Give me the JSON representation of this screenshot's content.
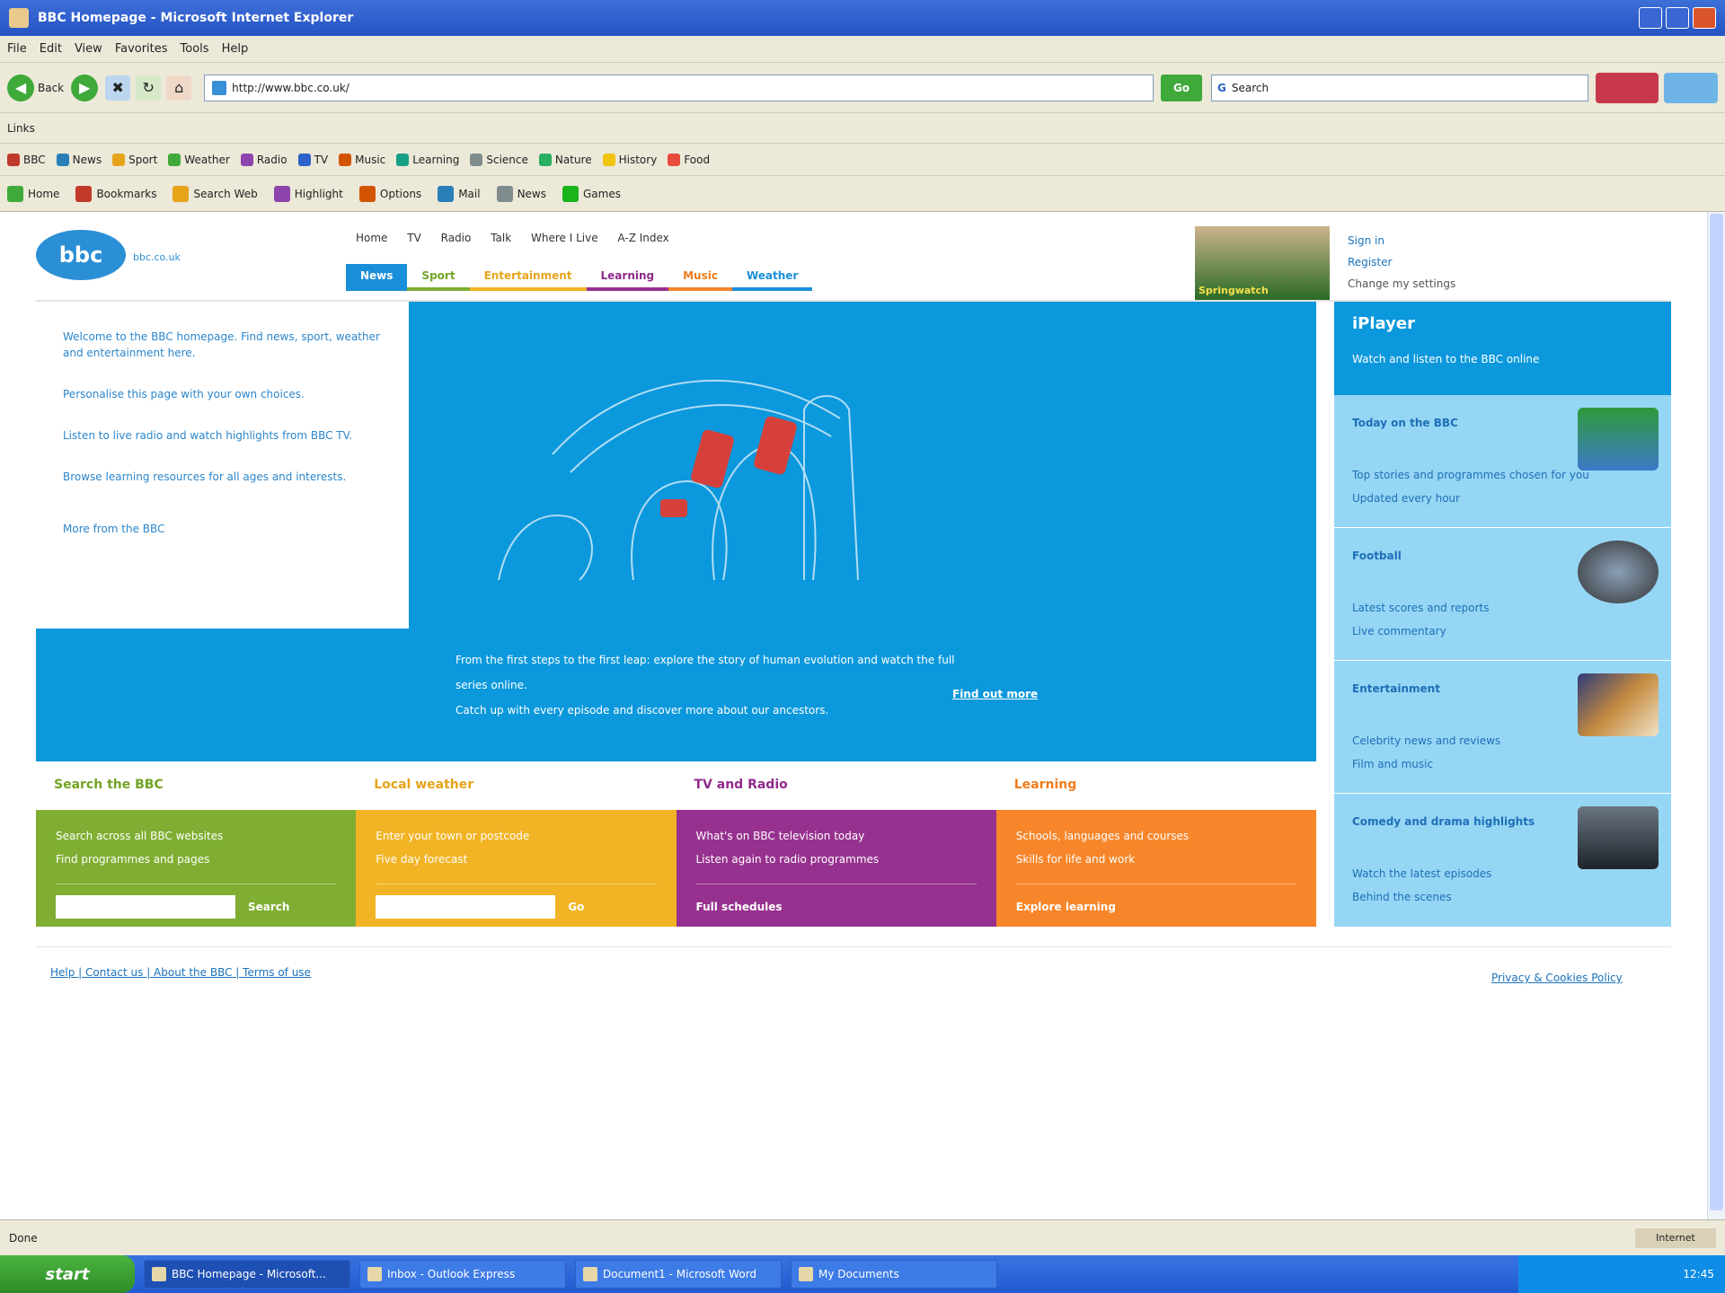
{
  "window": {
    "title": "BBC Homepage - Microsoft Internet Explorer"
  },
  "menu": [
    "File",
    "Edit",
    "View",
    "Favorites",
    "Tools",
    "Help"
  ],
  "toolbar": {
    "back_label": "Back",
    "forward_label": "",
    "address_value": "http://www.bbc.co.uk/",
    "go_label": "Go",
    "search_placeholder": "Search"
  },
  "links_bar": {
    "label": "Links"
  },
  "favorites": [
    "BBC",
    "News",
    "Sport",
    "Weather",
    "Radio",
    "TV",
    "Music",
    "Learning",
    "Science",
    "Nature",
    "History",
    "Food"
  ],
  "toolbar2": [
    "Home",
    "Bookmarks",
    "Search Web",
    "Highlight",
    "Options",
    "Mail",
    "News",
    "Games"
  ],
  "site": {
    "logo_text": "bbc",
    "logo_tag": "bbc.co.uk",
    "top_links": [
      "Home",
      "TV",
      "Radio",
      "Talk",
      "Where I Live",
      "A-Z Index"
    ],
    "tabs": [
      "News",
      "Sport",
      "Entertainment",
      "Learning",
      "Music",
      "Weather"
    ],
    "promo_text": "Springwatch",
    "right_links": [
      "Sign in",
      "Register",
      "Change my settings"
    ]
  },
  "intro": {
    "paragraphs": [
      "Welcome to the BBC homepage. Find news, sport, weather and entertainment here.",
      "Personalise this page with your own choices.",
      "Listen to live radio and watch highlights from BBC TV.",
      "Browse learning resources for all ages and interests.",
      "More from the BBC"
    ]
  },
  "hero": {
    "caption": [
      "From the first steps to the first leap: explore the story of human evolution and watch the full series online.",
      "Catch up with every episode and discover more about our ancestors."
    ],
    "more": "Find out more"
  },
  "boxes": [
    {
      "title": "Search the BBC",
      "lines": [
        "Search across all BBC websites",
        "Find programmes and pages"
      ],
      "go": "Search",
      "has_input": true
    },
    {
      "title": "Local weather",
      "lines": [
        "Enter your town or postcode",
        "Five day forecast"
      ],
      "go": "Go",
      "has_input": true
    },
    {
      "title": "TV and Radio",
      "lines": [
        "What's on BBC television today",
        "Listen again to radio programmes"
      ],
      "go": "Full schedules",
      "has_input": false
    },
    {
      "title": "Learning",
      "lines": [
        "Schools, languages and courses",
        "Skills for life and work"
      ],
      "go": "Explore learning",
      "has_input": false
    }
  ],
  "rightcol": {
    "logo": "iPlayer",
    "subtitle": "Watch and listen to the BBC online",
    "items": [
      {
        "title": "Today on the BBC",
        "lines": [
          "Top stories and programmes chosen for you",
          "Updated every hour"
        ]
      },
      {
        "title": "Football",
        "lines": [
          "Latest scores and reports",
          "Live commentary"
        ]
      },
      {
        "title": "Entertainment",
        "lines": [
          "Celebrity news and reviews",
          "Film and music"
        ]
      },
      {
        "title": "Comedy and drama highlights",
        "lines": [
          "Watch the latest episodes",
          "Behind the scenes"
        ]
      }
    ]
  },
  "footer": {
    "left": "Help | Contact us | About the BBC | Terms of use",
    "right": "Privacy & Cookies Policy"
  },
  "status": {
    "text": "Done",
    "zone": "Internet"
  },
  "taskbar": {
    "start": "start",
    "tasks": [
      "BBC Homepage - Microsoft...",
      "Inbox - Outlook Express",
      "Document1 - Microsoft Word",
      "My Documents"
    ],
    "clock": "12:45"
  },
  "colors": {
    "accent": "#0b98dc",
    "green": "#7fae32",
    "yellow": "#f2b424",
    "purple": "#97318f",
    "orange": "#f7862a"
  }
}
